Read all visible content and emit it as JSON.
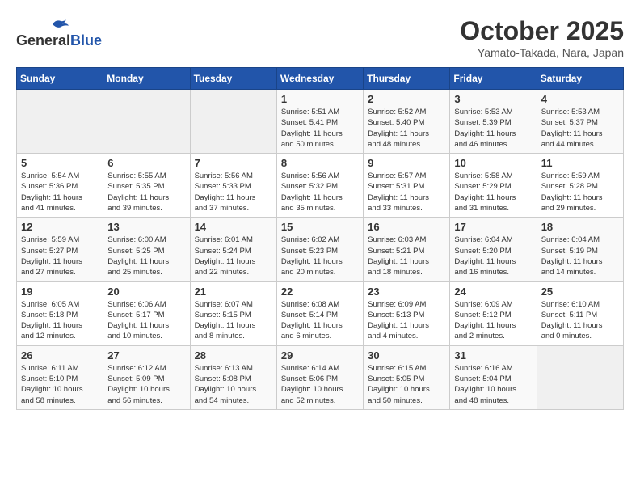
{
  "header": {
    "logo_general": "General",
    "logo_blue": "Blue",
    "month": "October 2025",
    "location": "Yamato-Takada, Nara, Japan"
  },
  "weekdays": [
    "Sunday",
    "Monday",
    "Tuesday",
    "Wednesday",
    "Thursday",
    "Friday",
    "Saturday"
  ],
  "weeks": [
    [
      {
        "day": "",
        "detail": ""
      },
      {
        "day": "",
        "detail": ""
      },
      {
        "day": "",
        "detail": ""
      },
      {
        "day": "1",
        "detail": "Sunrise: 5:51 AM\nSunset: 5:41 PM\nDaylight: 11 hours\nand 50 minutes."
      },
      {
        "day": "2",
        "detail": "Sunrise: 5:52 AM\nSunset: 5:40 PM\nDaylight: 11 hours\nand 48 minutes."
      },
      {
        "day": "3",
        "detail": "Sunrise: 5:53 AM\nSunset: 5:39 PM\nDaylight: 11 hours\nand 46 minutes."
      },
      {
        "day": "4",
        "detail": "Sunrise: 5:53 AM\nSunset: 5:37 PM\nDaylight: 11 hours\nand 44 minutes."
      }
    ],
    [
      {
        "day": "5",
        "detail": "Sunrise: 5:54 AM\nSunset: 5:36 PM\nDaylight: 11 hours\nand 41 minutes."
      },
      {
        "day": "6",
        "detail": "Sunrise: 5:55 AM\nSunset: 5:35 PM\nDaylight: 11 hours\nand 39 minutes."
      },
      {
        "day": "7",
        "detail": "Sunrise: 5:56 AM\nSunset: 5:33 PM\nDaylight: 11 hours\nand 37 minutes."
      },
      {
        "day": "8",
        "detail": "Sunrise: 5:56 AM\nSunset: 5:32 PM\nDaylight: 11 hours\nand 35 minutes."
      },
      {
        "day": "9",
        "detail": "Sunrise: 5:57 AM\nSunset: 5:31 PM\nDaylight: 11 hours\nand 33 minutes."
      },
      {
        "day": "10",
        "detail": "Sunrise: 5:58 AM\nSunset: 5:29 PM\nDaylight: 11 hours\nand 31 minutes."
      },
      {
        "day": "11",
        "detail": "Sunrise: 5:59 AM\nSunset: 5:28 PM\nDaylight: 11 hours\nand 29 minutes."
      }
    ],
    [
      {
        "day": "12",
        "detail": "Sunrise: 5:59 AM\nSunset: 5:27 PM\nDaylight: 11 hours\nand 27 minutes."
      },
      {
        "day": "13",
        "detail": "Sunrise: 6:00 AM\nSunset: 5:25 PM\nDaylight: 11 hours\nand 25 minutes."
      },
      {
        "day": "14",
        "detail": "Sunrise: 6:01 AM\nSunset: 5:24 PM\nDaylight: 11 hours\nand 22 minutes."
      },
      {
        "day": "15",
        "detail": "Sunrise: 6:02 AM\nSunset: 5:23 PM\nDaylight: 11 hours\nand 20 minutes."
      },
      {
        "day": "16",
        "detail": "Sunrise: 6:03 AM\nSunset: 5:21 PM\nDaylight: 11 hours\nand 18 minutes."
      },
      {
        "day": "17",
        "detail": "Sunrise: 6:04 AM\nSunset: 5:20 PM\nDaylight: 11 hours\nand 16 minutes."
      },
      {
        "day": "18",
        "detail": "Sunrise: 6:04 AM\nSunset: 5:19 PM\nDaylight: 11 hours\nand 14 minutes."
      }
    ],
    [
      {
        "day": "19",
        "detail": "Sunrise: 6:05 AM\nSunset: 5:18 PM\nDaylight: 11 hours\nand 12 minutes."
      },
      {
        "day": "20",
        "detail": "Sunrise: 6:06 AM\nSunset: 5:17 PM\nDaylight: 11 hours\nand 10 minutes."
      },
      {
        "day": "21",
        "detail": "Sunrise: 6:07 AM\nSunset: 5:15 PM\nDaylight: 11 hours\nand 8 minutes."
      },
      {
        "day": "22",
        "detail": "Sunrise: 6:08 AM\nSunset: 5:14 PM\nDaylight: 11 hours\nand 6 minutes."
      },
      {
        "day": "23",
        "detail": "Sunrise: 6:09 AM\nSunset: 5:13 PM\nDaylight: 11 hours\nand 4 minutes."
      },
      {
        "day": "24",
        "detail": "Sunrise: 6:09 AM\nSunset: 5:12 PM\nDaylight: 11 hours\nand 2 minutes."
      },
      {
        "day": "25",
        "detail": "Sunrise: 6:10 AM\nSunset: 5:11 PM\nDaylight: 11 hours\nand 0 minutes."
      }
    ],
    [
      {
        "day": "26",
        "detail": "Sunrise: 6:11 AM\nSunset: 5:10 PM\nDaylight: 10 hours\nand 58 minutes."
      },
      {
        "day": "27",
        "detail": "Sunrise: 6:12 AM\nSunset: 5:09 PM\nDaylight: 10 hours\nand 56 minutes."
      },
      {
        "day": "28",
        "detail": "Sunrise: 6:13 AM\nSunset: 5:08 PM\nDaylight: 10 hours\nand 54 minutes."
      },
      {
        "day": "29",
        "detail": "Sunrise: 6:14 AM\nSunset: 5:06 PM\nDaylight: 10 hours\nand 52 minutes."
      },
      {
        "day": "30",
        "detail": "Sunrise: 6:15 AM\nSunset: 5:05 PM\nDaylight: 10 hours\nand 50 minutes."
      },
      {
        "day": "31",
        "detail": "Sunrise: 6:16 AM\nSunset: 5:04 PM\nDaylight: 10 hours\nand 48 minutes."
      },
      {
        "day": "",
        "detail": ""
      }
    ]
  ]
}
